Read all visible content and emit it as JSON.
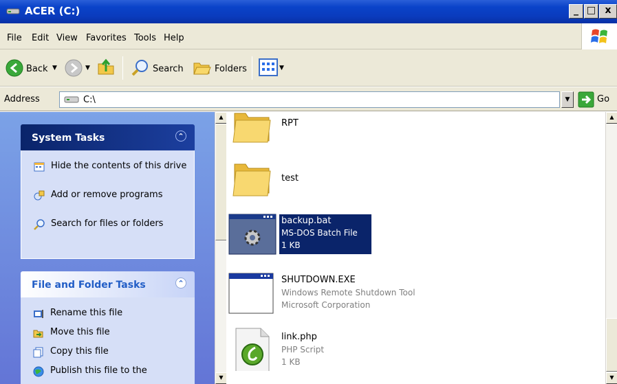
{
  "window": {
    "title": "ACER (C:)"
  },
  "caption_buttons": {
    "minimize": "_",
    "maximize": "□",
    "close": "x"
  },
  "menu": {
    "items": [
      "File",
      "Edit",
      "View",
      "Favorites",
      "Tools",
      "Help"
    ]
  },
  "toolbar": {
    "back_label": "Back",
    "search_label": "Search",
    "folders_label": "Folders"
  },
  "address": {
    "label": "Address",
    "value": "C:\\",
    "go_label": "Go"
  },
  "system_tasks": {
    "title": "System Tasks",
    "items": [
      "Hide the contents of this drive",
      "Add or remove programs",
      "Search for files or folders"
    ]
  },
  "file_folder_tasks": {
    "title": "File and Folder Tasks",
    "items": [
      "Rename this file",
      "Move this file",
      "Copy this file",
      "Publish this file to the"
    ]
  },
  "files": [
    {
      "name": "RPT",
      "type": "folder"
    },
    {
      "name": "test",
      "type": "folder"
    },
    {
      "name": "backup.bat",
      "desc": "MS-DOS Batch File",
      "size": "1 KB",
      "selected": true
    },
    {
      "name": "SHUTDOWN.EXE",
      "desc": "Windows Remote Shutdown Tool",
      "company": "Microsoft Corporation"
    },
    {
      "name": "link.php",
      "desc": "PHP Script",
      "size": "1 KB"
    }
  ],
  "colors": {
    "titlebar": "#0a43c9",
    "panel_header_blue": "#0a246a",
    "panel_header_light": "#ffffff",
    "selection": "#0a246a",
    "task_pane_bg": "#6375d6"
  }
}
